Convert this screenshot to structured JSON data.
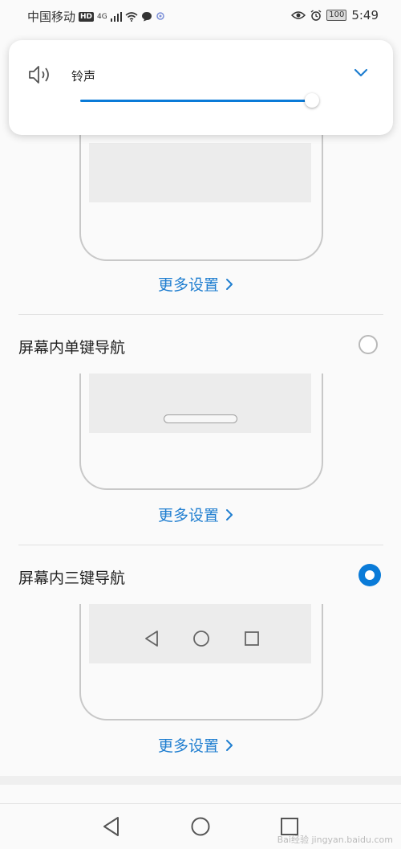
{
  "status_bar": {
    "carrier": "中国移动",
    "hd": "HD",
    "network": "4G",
    "battery": "100",
    "time": "5:49"
  },
  "volume_panel": {
    "label": "铃声",
    "level": 0.98
  },
  "options": [
    {
      "title": "",
      "link": "更多设置",
      "selected": false
    },
    {
      "title": "屏幕内单键导航",
      "link": "更多设置",
      "selected": false
    },
    {
      "title": "屏幕内三键导航",
      "link": "更多设置",
      "selected": true
    }
  ],
  "colors": {
    "accent": "#0a7bd8",
    "link": "#1f7ed0",
    "frame": "#c8c8c8",
    "screen": "#ececec"
  },
  "watermark": "Bai经验 jingyan.baidu.com"
}
